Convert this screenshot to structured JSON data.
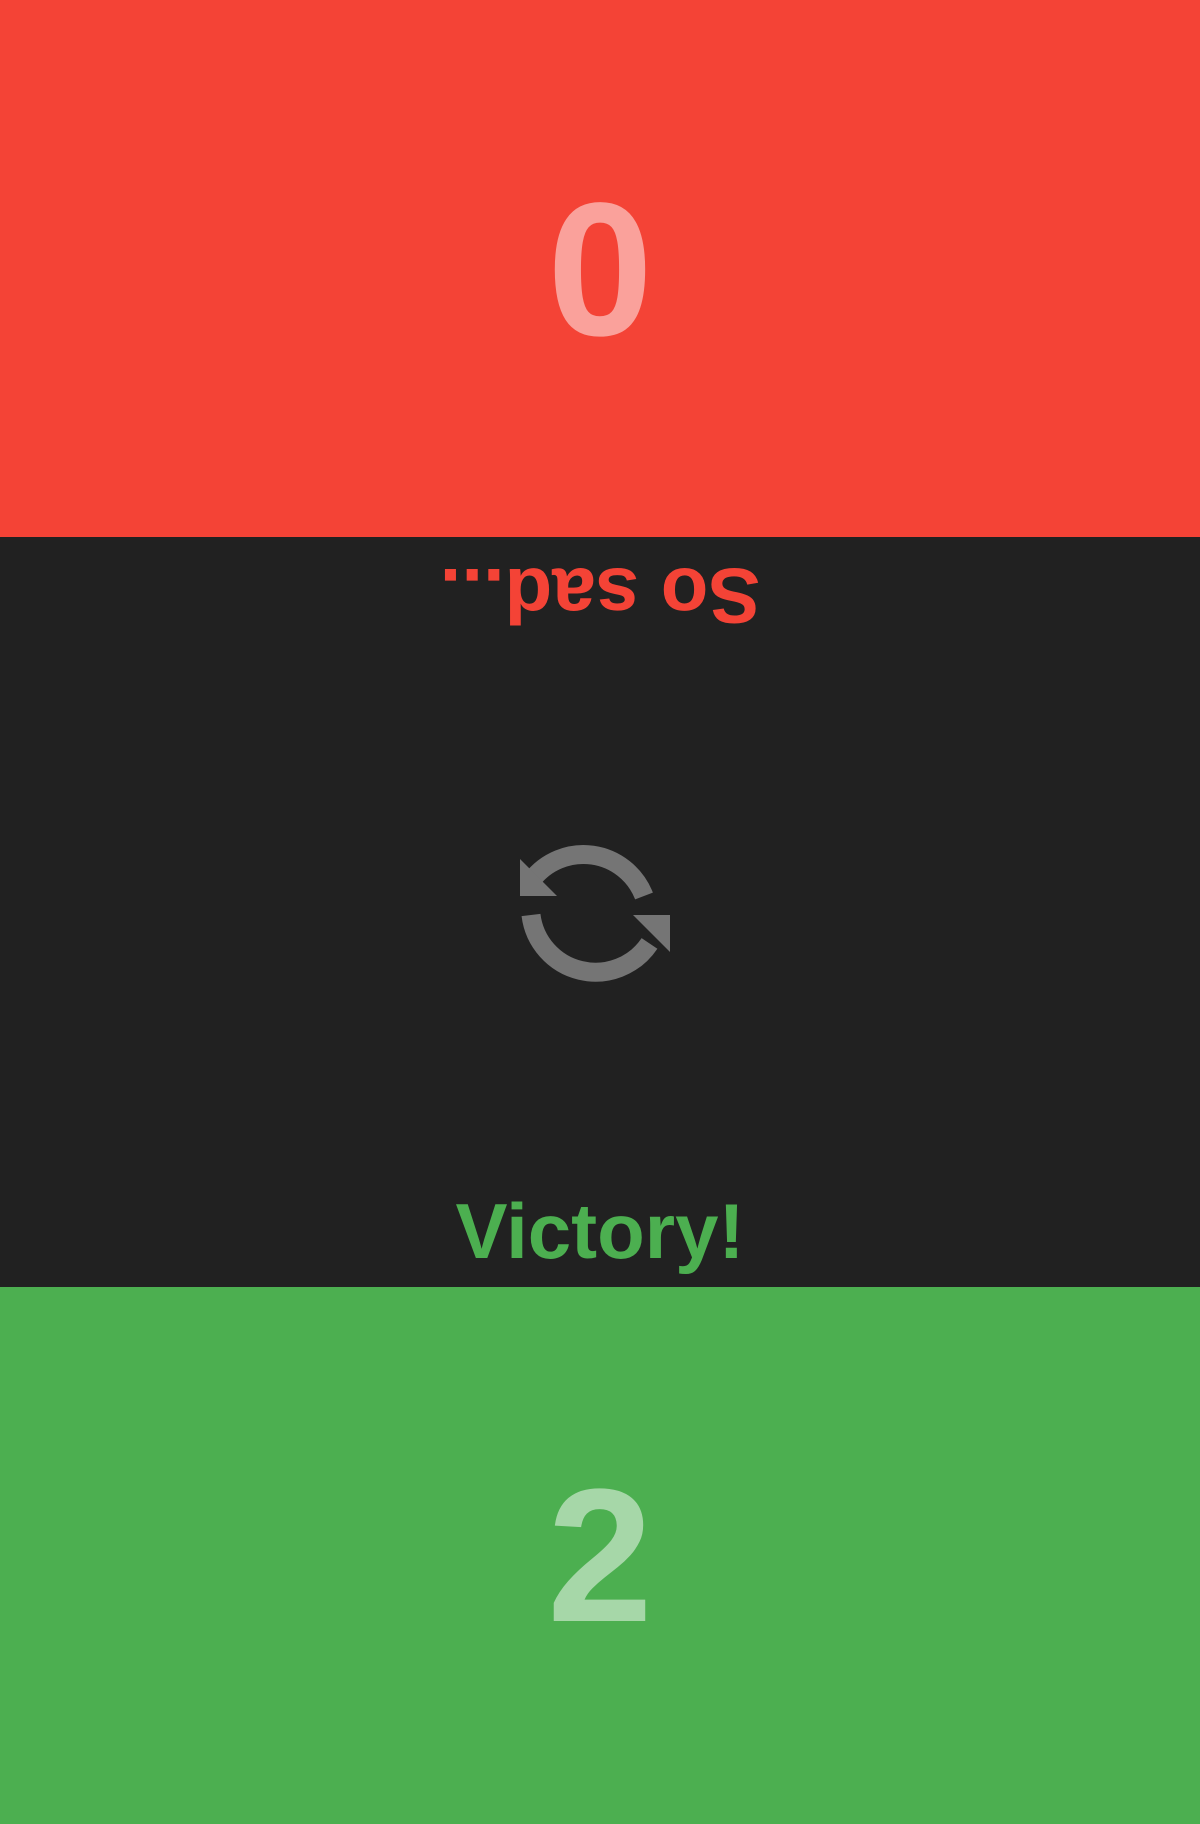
{
  "players": {
    "top": {
      "score": "0",
      "message": "So sad...",
      "color": "#F44336",
      "orientation": "upside-down"
    },
    "bottom": {
      "score": "2",
      "message": "Victory!",
      "color": "#4CAF50",
      "orientation": "upright"
    }
  },
  "controls": {
    "reset_icon": "refresh-icon",
    "reset_icon_color": "#757575"
  },
  "colors": {
    "background": "#212121",
    "score_text": "rgba(255,255,255,0.5)"
  }
}
